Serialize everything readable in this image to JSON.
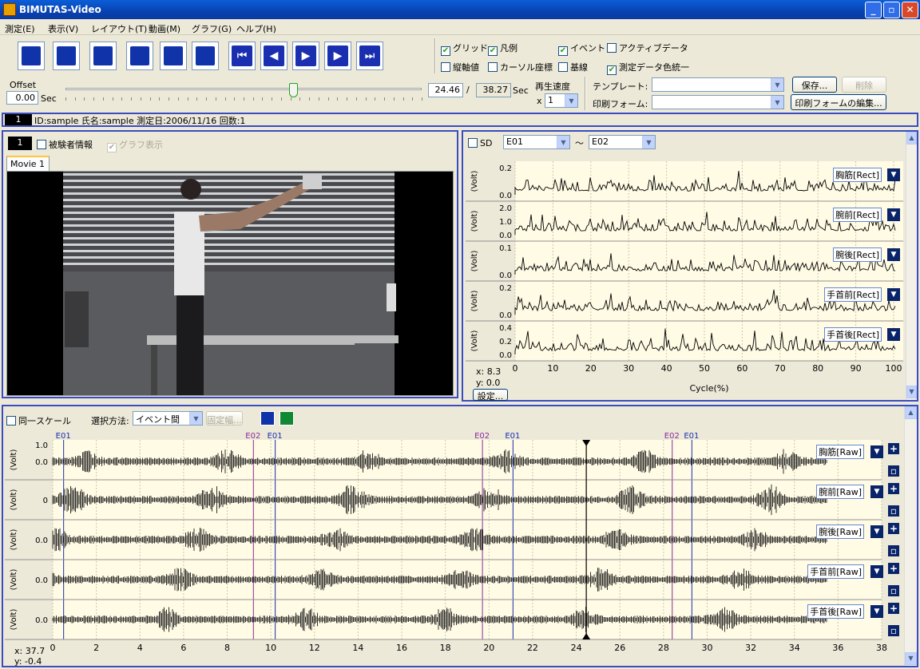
{
  "window": {
    "title": "BIMUTAS-Video"
  },
  "menu": [
    "測定(E)",
    "表示(V)",
    "レイアウト(T)",
    "動画(M)",
    "グラフ(G)",
    "ヘルプ(H)"
  ],
  "toolbar_icons": [
    "database-icon",
    "folder-open-icon",
    "printer-icon",
    "pen-tool-icon",
    "layers-icon",
    "grid-wand-icon"
  ],
  "player": [
    "skip-start-icon",
    "step-back-icon",
    "play-icon",
    "step-forward-icon",
    "skip-end-icon"
  ],
  "options": {
    "grid": "グリッド",
    "legend": "凡例",
    "event": "イベント",
    "active_data": "アクティブデータ",
    "vertical_axis": "縦軸値",
    "cursor_coords": "カーソル座標",
    "baseline": "基線",
    "unify_color": "測定データ色統一"
  },
  "offset": {
    "label": "Offset",
    "value": "0.00",
    "unit": "Sec"
  },
  "time": {
    "current": "24.46",
    "slash": "/",
    "total": "38.27",
    "unit": "Sec",
    "slider_fraction": 0.639
  },
  "playback": {
    "label": "再生速度",
    "prefix": "x",
    "value": "1"
  },
  "template": {
    "label": "テンプレート:",
    "value": ""
  },
  "print_form": {
    "label": "印刷フォーム:",
    "value": ""
  },
  "buttons": {
    "save": "保存...",
    "delete": "削除",
    "edit_form": "印刷フォームの編集..."
  },
  "record": {
    "index": "1",
    "info": "ID:sample 氏名:sample 測定日:2006/11/16 回数:1"
  },
  "video": {
    "index": "1",
    "subject_info": "被験者情報",
    "show_graph": "グラフ表示",
    "tab": "Movie 1"
  },
  "upper": {
    "sd": "SD",
    "from": "E01",
    "tilde": "〜",
    "to": "E02",
    "cursor_x": "x:  8.3",
    "cursor_y": "y:   0.0",
    "settings": "設定...",
    "xlabel": "Cycle(%)",
    "ylabel": "(Volt)",
    "channels": [
      {
        "name": "胸筋[Rect]",
        "ticks": [
          "0.2",
          "0.0"
        ]
      },
      {
        "name": "腕前[Rect]",
        "ticks": [
          "2.0",
          "1.0",
          "0.0"
        ]
      },
      {
        "name": "腕後[Rect]",
        "ticks": [
          "0.1",
          "0.0"
        ]
      },
      {
        "name": "手首前[Rect]",
        "ticks": [
          "0.2",
          "0.0"
        ]
      },
      {
        "name": "手首後[Rect]",
        "ticks": [
          "0.4",
          "0.2",
          "0.0"
        ]
      }
    ],
    "xticks": [
      "0",
      "10",
      "20",
      "30",
      "40",
      "50",
      "60",
      "70",
      "80",
      "90",
      "100"
    ]
  },
  "lower": {
    "same_scale": "同一スケール",
    "method_label": "選択方法:",
    "method": "イベント間",
    "fixed": "固定幅...",
    "ylabel": "(Volt)",
    "cursor_x": "x:  37.7",
    "cursor_y": "y:   -0.4",
    "channels": [
      {
        "name": "胸筋[Raw]",
        "ticks": [
          "1.0",
          "0.0"
        ]
      },
      {
        "name": "腕前[Raw]",
        "ticks": [
          "0"
        ]
      },
      {
        "name": "腕後[Raw]",
        "ticks": [
          "0.0"
        ]
      },
      {
        "name": "手首前[Raw]",
        "ticks": [
          "0.0"
        ]
      },
      {
        "name": "手首後[Raw]",
        "ticks": [
          "0.0"
        ]
      }
    ],
    "xticks": [
      "0",
      "2",
      "4",
      "6",
      "8",
      "10",
      "12",
      "14",
      "16",
      "18",
      "20",
      "22",
      "24",
      "26",
      "28",
      "30",
      "32",
      "34",
      "36",
      "38"
    ],
    "events": [
      {
        "label": "E01",
        "t": 0.5
      },
      {
        "label": "E02",
        "t": 9.2
      },
      {
        "label": "E01",
        "t": 10.2
      },
      {
        "label": "E02",
        "t": 19.7
      },
      {
        "label": "E01",
        "t": 21.1
      },
      {
        "label": "E02",
        "t": 28.4
      },
      {
        "label": "E01",
        "t": 29.3
      }
    ],
    "cursor_t": 24.46
  }
}
